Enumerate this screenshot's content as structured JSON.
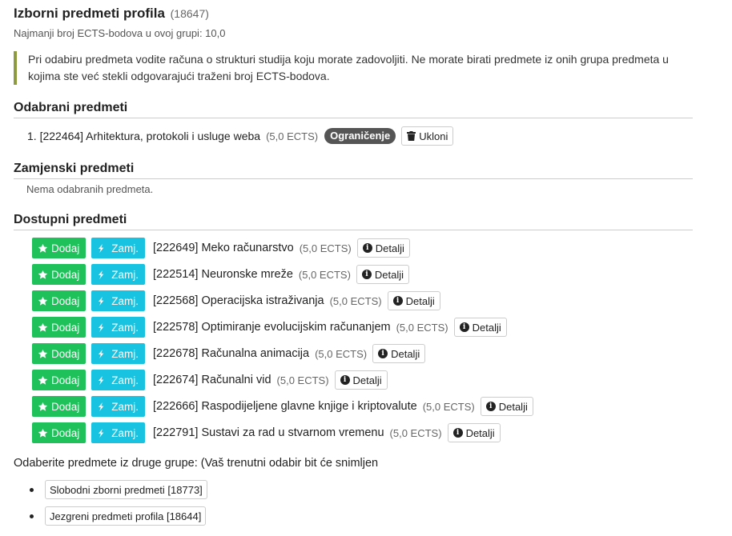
{
  "group": {
    "title": "Izborni predmeti profila",
    "code": "(18647)",
    "min_ects": "Najmanji broj ECTS-bodova u ovoj grupi: 10,0",
    "note": "Pri odabiru predmeta vodite računa o strukturi studija koju morate zadovoljiti. Ne morate birati predmete iz onih grupa predmeta u kojima ste već stekli odgovarajući traženi broj ECTS-bodova."
  },
  "selected": {
    "title": "Odabrani predmeti",
    "items": [
      {
        "label": "1. [222464] Arhitektura, protokoli i usluge weba",
        "ects": "(5,0 ECTS)",
        "badge": "Ograničenje",
        "remove_label": "Ukloni"
      }
    ]
  },
  "replacement": {
    "title": "Zamjenski predmeti",
    "empty": "Nema odabranih predmeta."
  },
  "available": {
    "title": "Dostupni predmeti",
    "add_label": "Dodaj",
    "alt_label": "Zamj.",
    "details_label": "Detalji",
    "items": [
      {
        "name": "[222649] Meko računarstvo",
        "ects": "(5,0 ECTS)"
      },
      {
        "name": "[222514] Neuronske mreže",
        "ects": "(5,0 ECTS)"
      },
      {
        "name": "[222568] Operacijska istraživanja",
        "ects": "(5,0 ECTS)"
      },
      {
        "name": "[222578] Optimiranje evolucijskim računanjem",
        "ects": "(5,0 ECTS)"
      },
      {
        "name": "[222678] Računalna animacija",
        "ects": "(5,0 ECTS)"
      },
      {
        "name": "[222674] Računalni vid",
        "ects": "(5,0 ECTS)"
      },
      {
        "name": "[222666] Raspodijeljene glavne knjige i kriptovalute",
        "ects": "(5,0 ECTS)"
      },
      {
        "name": "[222791] Sustavi za rad u stvarnom vremenu",
        "ects": "(5,0 ECTS)"
      }
    ]
  },
  "other_groups": {
    "prompt": "Odaberite predmete iz druge grupe: (Vaš trenutni odabir bit će snimljen",
    "items": [
      {
        "label": "Slobodni zborni predmeti [18773]"
      },
      {
        "label": "Jezgreni predmeti profila [18644]"
      }
    ]
  },
  "colors": {
    "add": "#1fc25a",
    "alt": "#17c3e1",
    "badge": "#555555",
    "note_border": "#8d9a3e"
  },
  "icons": {
    "remove": "trash-icon",
    "add": "star-icon",
    "alt": "swap-icon",
    "details": "info-icon",
    "bullet": "bullet-icon"
  }
}
